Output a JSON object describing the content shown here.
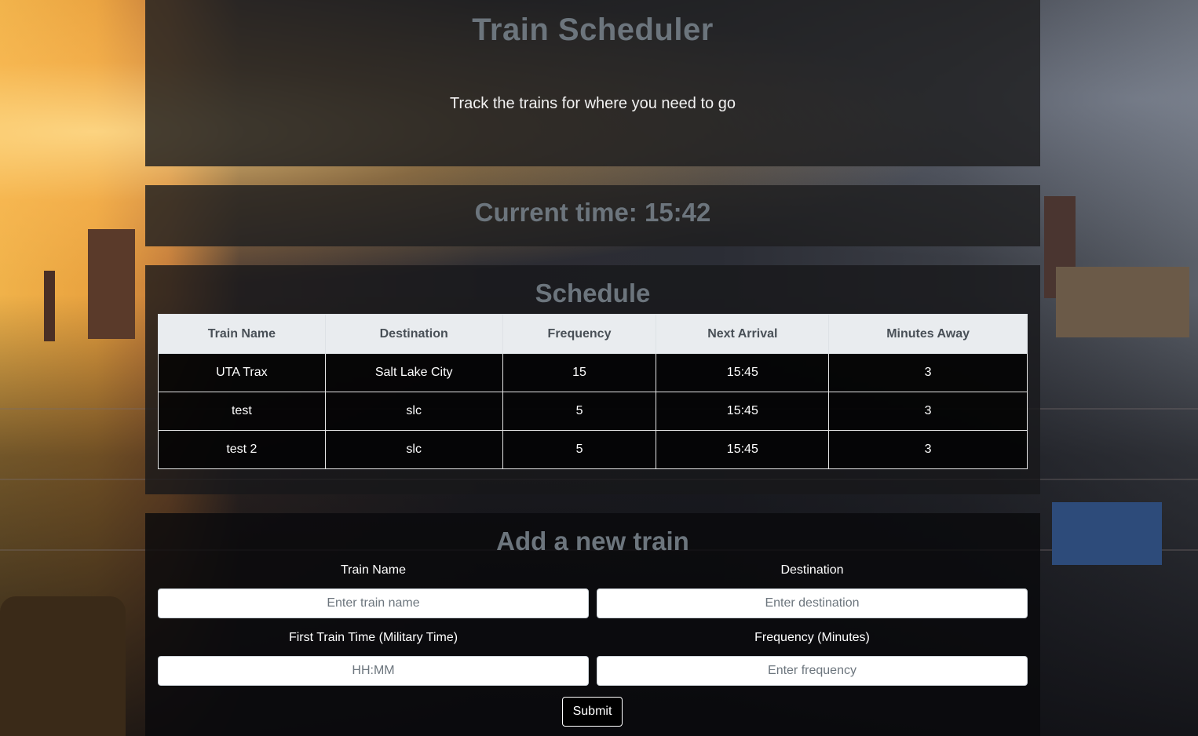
{
  "header": {
    "title": "Train Scheduler",
    "subtitle": "Track the trains for where you need to go"
  },
  "clock": {
    "text": "Current time: 15:42"
  },
  "schedule": {
    "heading": "Schedule",
    "columns": [
      "Train Name",
      "Destination",
      "Frequency",
      "Next Arrival",
      "Minutes Away"
    ],
    "rows": [
      [
        "UTA Trax",
        "Salt Lake City",
        "15",
        "15:45",
        "3"
      ],
      [
        "test",
        "slc",
        "5",
        "15:45",
        "3"
      ],
      [
        "test 2",
        "slc",
        "5",
        "15:45",
        "3"
      ]
    ]
  },
  "form": {
    "heading": "Add a new train",
    "train_name": {
      "label": "Train Name",
      "placeholder": "Enter train name",
      "value": ""
    },
    "destination": {
      "label": "Destination",
      "placeholder": "Enter destination",
      "value": ""
    },
    "first_time": {
      "label": "First Train Time (Military Time)",
      "placeholder": "HH:MM",
      "value": ""
    },
    "frequency": {
      "label": "Frequency (Minutes)",
      "placeholder": "Enter frequency",
      "value": ""
    },
    "submit_label": "Submit"
  }
}
